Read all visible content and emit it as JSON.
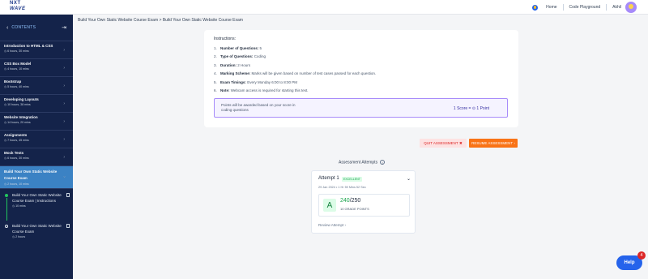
{
  "header": {
    "logo_line1": "NXT",
    "logo_line2": "WAVE",
    "nav": [
      "Home",
      "Code Playground"
    ],
    "user_name": "Akhil"
  },
  "sidebar": {
    "title": "CONTENTS",
    "items": [
      {
        "title": "Introduction to HTML & CSS",
        "sub": "6 hours, 30 mins"
      },
      {
        "title": "CSS Box Model",
        "sub": "4 hours, 10 mins"
      },
      {
        "title": "Bootstrap",
        "sub": "5 hours, 40 mins"
      },
      {
        "title": "Developing Layouts",
        "sub": "10 hours, 38 mins"
      },
      {
        "title": "Website Integration",
        "sub": "14 hours, 20 mins"
      },
      {
        "title": "Assignments",
        "sub": "7 hours, 45 mins"
      },
      {
        "title": "Mock Tests",
        "sub": "6 hours, 30 mins"
      }
    ],
    "active": {
      "title": "Build Your Own Static Website Course Exam",
      "sub": "2 hours, 10 mins"
    },
    "subitems": [
      {
        "title": "Build Your Own Static Website Course Exam | Instructions",
        "sub": "10 mins"
      },
      {
        "title": "Build Your Own Static Website Course Exam",
        "sub": "2 hours"
      }
    ]
  },
  "breadcrumb": "Build Your Own Static Website Course Exam > Build Your Own Static Website Course Exam",
  "instructions": {
    "heading": "Instructions:",
    "items": [
      {
        "num": "1.",
        "label": "Number of Questions:",
        "value": "5"
      },
      {
        "num": "2.",
        "label": "Type of Questions:",
        "value": "Coding"
      },
      {
        "num": "3.",
        "label": "Duration:",
        "value": "2 Hours"
      },
      {
        "num": "4.",
        "label": "Marking Scheme:",
        "value": "Marks will be given based on number of test cases passed for each question."
      },
      {
        "num": "5.",
        "label": "Exam Timings:",
        "value": "Every Monday 6:00 to 8:00 PM"
      },
      {
        "num": "6.",
        "label": "Note:",
        "value": "Webcam access is required for starting this test."
      }
    ],
    "notice": "Points will be awarded based on your score in coding questions",
    "score_rule": "1 Score = ⊙ 1 Point"
  },
  "actions": {
    "quit": "QUIT ASSESSMENT",
    "resume": "RESUME ASSESSMENT"
  },
  "attempts": {
    "heading": "Assessment Attempts",
    "card": {
      "title": "Attempt 1",
      "badge": "EXCELLENT",
      "date": "29 Jan 2024 • 1 Hr 59 Mins 52 Sec",
      "grade": "A",
      "score": "240",
      "total": "/250",
      "grade_points": "10 GRADE POINTS",
      "review": "Review Attempt"
    }
  },
  "help": {
    "label": "Help",
    "count": "4"
  }
}
